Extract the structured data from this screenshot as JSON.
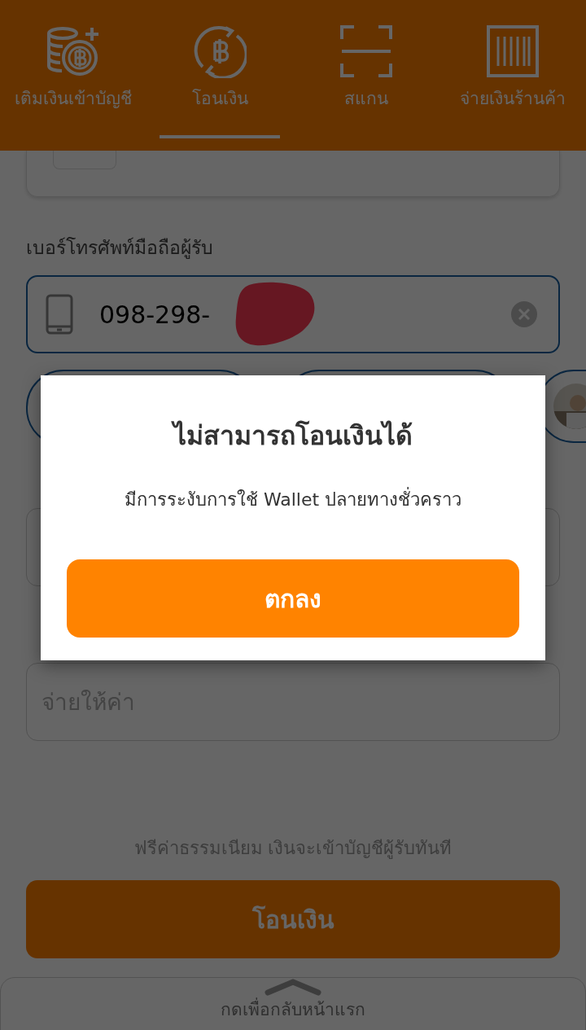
{
  "tabs": [
    {
      "label": "เติมเงินเข้าบัญชี",
      "selected": false
    },
    {
      "label": "โอนเงิน",
      "selected": true
    },
    {
      "label": "สแกน",
      "selected": false
    },
    {
      "label": "จ่ายเงินร้านค้า",
      "selected": false
    }
  ],
  "recipient": {
    "label": "เบอร์โทรศัพท์มือถือผู้รับ",
    "value": "098-298-"
  },
  "note_field": {
    "placeholder": "จ่ายให้ค่า"
  },
  "fee_note": "ฟรีค่าธรรมเนียม เงินจะเข้าบัญชีผู้รับทันที",
  "transfer_button": "โอนเงิน",
  "bottom_sheet": {
    "label": "กดเพื่อกลับหน้าแรก"
  },
  "dialog": {
    "title": "ไม่สามารถโอนเงินได้",
    "message": "มีการระงับการใช้ Wallet ปลายทางชั่วคราว",
    "button": "ตกลง"
  }
}
